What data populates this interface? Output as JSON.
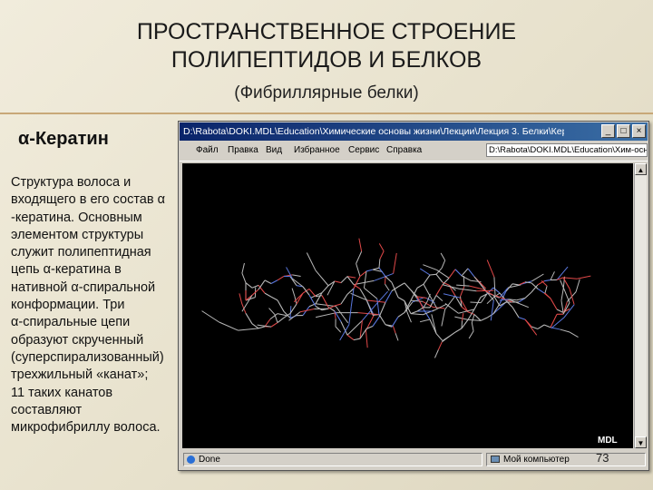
{
  "slide": {
    "title_line1": "ПРОСТРАНСТВЕННОЕ СТРОЕНИЕ",
    "title_line2": "ПОЛИПЕПТИДОВ И БЕЛКОВ",
    "subtitle": "(Фибриллярные белки)",
    "section_heading": "α-Кератин",
    "body_text": "Структура волоса и\nвходящего в его состав α\n-кератина. Основным\nэлементом структуры\nслужит полипептидная\nцепь α-кератина в\nнативной α-спиральной\nконформации. Три\nα-спиральные цепи\nобразуют скрученный\n(суперспирализованный)\nтрехжильный «канат»;\n11 таких канатов\nсоставляют\nмикрофибриллу волоса.",
    "page_number": "73"
  },
  "window": {
    "title": "D:\\Rabota\\DOKI.MDL\\Education\\Химические основы жизни\\Лекции\\Лекция 3. Белки\\Керат...",
    "menu": [
      "Файл",
      "Правка",
      "Вид",
      "Избранное",
      "Сервис",
      "Справка"
    ],
    "address": "D:\\Rabota\\DOKI.MDL\\Education\\Хим-осно",
    "status_left": "Done",
    "status_right": "Мой компьютер",
    "logo": "MDL",
    "colors": {
      "titlebar": "#0a246a",
      "viewer_bg": "#000000",
      "atom_carbon": "#b9b9b9",
      "atom_oxygen": "#e04848",
      "atom_nitrogen": "#5a78e0"
    }
  }
}
